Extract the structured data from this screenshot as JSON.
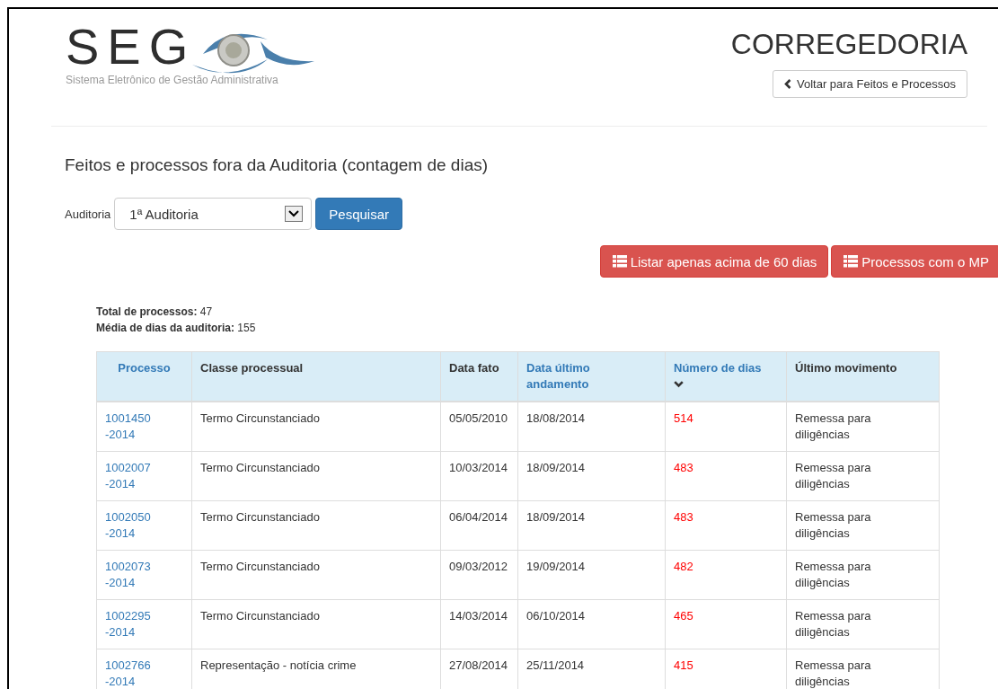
{
  "header": {
    "logo_text": "SEG",
    "logo_subtitle": "Sistema Eletrônico de Gestão Administrativa",
    "title": "CORREGEDORIA",
    "back_button": "Voltar para Feitos e Processos"
  },
  "page_title": "Feitos e processos fora da Auditoria (contagem de dias)",
  "filter": {
    "label": "Auditoria",
    "value": "1ª Auditoria",
    "button": "Pesquisar"
  },
  "actions": [
    "Listar apenas acima de 60 dias",
    "Processos com o MP"
  ],
  "summary": [
    {
      "label": "Total de processos:",
      "value": "47"
    },
    {
      "label": "Média de dias da auditoria:",
      "value": "155"
    }
  ],
  "table": {
    "columns": [
      {
        "label": "Processo",
        "link": true,
        "sorted": false
      },
      {
        "label": "Classe processual",
        "link": false,
        "sorted": false
      },
      {
        "label": "Data fato",
        "link": false,
        "sorted": false
      },
      {
        "label": "Data último andamento",
        "link": true,
        "sorted": false
      },
      {
        "label": "Número de dias",
        "link": true,
        "sorted": true
      },
      {
        "label": "Último movimento",
        "link": false,
        "sorted": false
      }
    ],
    "rows": [
      [
        "1001450 -2014",
        "Termo Circunstanciado",
        "05/05/2010",
        "18/08/2014",
        "514",
        "Remessa para diligências"
      ],
      [
        "1002007 -2014",
        "Termo Circunstanciado",
        "10/03/2014",
        "18/09/2014",
        "483",
        "Remessa para diligências"
      ],
      [
        "1002050 -2014",
        "Termo Circunstanciado",
        "06/04/2014",
        "18/09/2014",
        "483",
        "Remessa para diligências"
      ],
      [
        "1002073 -2014",
        "Termo Circunstanciado",
        "09/03/2012",
        "19/09/2014",
        "482",
        "Remessa para diligências"
      ],
      [
        "1002295 -2014",
        "Termo Circunstanciado",
        "14/03/2014",
        "06/10/2014",
        "465",
        "Remessa para diligências"
      ],
      [
        "1002766 -2014",
        "Representação - notícia crime",
        "27/08/2014",
        "25/11/2014",
        "415",
        "Remessa para diligências"
      ]
    ]
  }
}
